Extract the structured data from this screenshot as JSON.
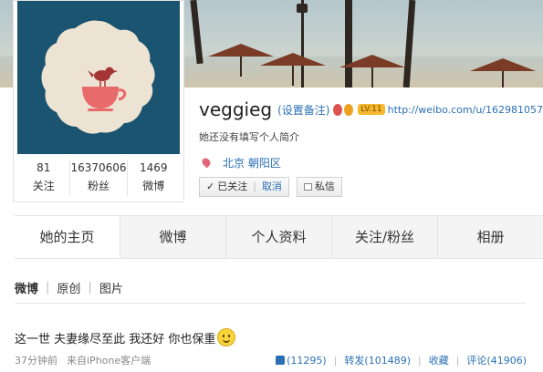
{
  "profile": {
    "username": "veggieg",
    "set_remark": "(设置备注)",
    "level_badge": "LV.11",
    "url": "http://weibo.com/u/162981057",
    "bio": "她还没有填写个人简介",
    "location": "北京 朝阳区"
  },
  "stats": [
    {
      "value": "81",
      "label": "关注"
    },
    {
      "value": "16370606",
      "label": "粉丝"
    },
    {
      "value": "1469",
      "label": "微博"
    }
  ],
  "actions": {
    "followed": "已关注",
    "cancel": "取消",
    "message": "私信"
  },
  "tabs": [
    "她的主页",
    "微博",
    "个人资料",
    "关注/粉丝",
    "相册"
  ],
  "subtabs": [
    "微博",
    "原创",
    "图片"
  ],
  "post": {
    "text": "这一世 夫妻缘尽至此 我还好 你也保重",
    "time": "37分钟前",
    "source": "来自iPhone客户端",
    "likes": "(11295)",
    "repost": "转发(101489)",
    "favorite": "收藏",
    "comment": "评论(41906)"
  },
  "colors": {
    "link": "#2a6fb5",
    "avatar_bg": "#1a5470",
    "teacup": "#e86a6a"
  }
}
